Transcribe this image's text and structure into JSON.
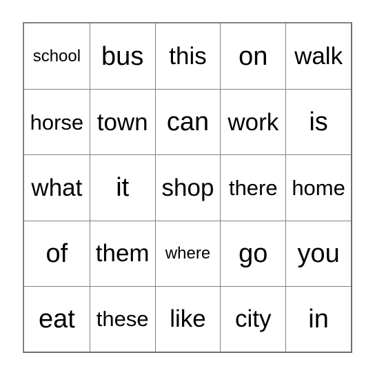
{
  "card": {
    "type": "bingo-card",
    "columns": 5,
    "rows": 5,
    "border_color": "#808080",
    "background_color": "#ffffff",
    "text_color": "#000000",
    "grid": [
      [
        {
          "word": "school",
          "size": "t-sm"
        },
        {
          "word": "bus",
          "size": "t-xl"
        },
        {
          "word": "this",
          "size": "t-lg"
        },
        {
          "word": "on",
          "size": "t-xl"
        },
        {
          "word": "walk",
          "size": "t-lg"
        }
      ],
      [
        {
          "word": "horse",
          "size": "t-md"
        },
        {
          "word": "town",
          "size": "t-lg"
        },
        {
          "word": "can",
          "size": "t-xl"
        },
        {
          "word": "work",
          "size": "t-lg"
        },
        {
          "word": "is",
          "size": "t-xl"
        }
      ],
      [
        {
          "word": "what",
          "size": "t-lg"
        },
        {
          "word": "it",
          "size": "t-xl"
        },
        {
          "word": "shop",
          "size": "t-lg"
        },
        {
          "word": "there",
          "size": "t-md"
        },
        {
          "word": "home",
          "size": "t-md"
        }
      ],
      [
        {
          "word": "of",
          "size": "t-xl"
        },
        {
          "word": "them",
          "size": "t-lg"
        },
        {
          "word": "where",
          "size": "t-sm"
        },
        {
          "word": "go",
          "size": "t-xl"
        },
        {
          "word": "you",
          "size": "t-xl"
        }
      ],
      [
        {
          "word": "eat",
          "size": "t-xl"
        },
        {
          "word": "these",
          "size": "t-md"
        },
        {
          "word": "like",
          "size": "t-lg"
        },
        {
          "word": "city",
          "size": "t-lg"
        },
        {
          "word": "in",
          "size": "t-xl"
        }
      ]
    ]
  }
}
